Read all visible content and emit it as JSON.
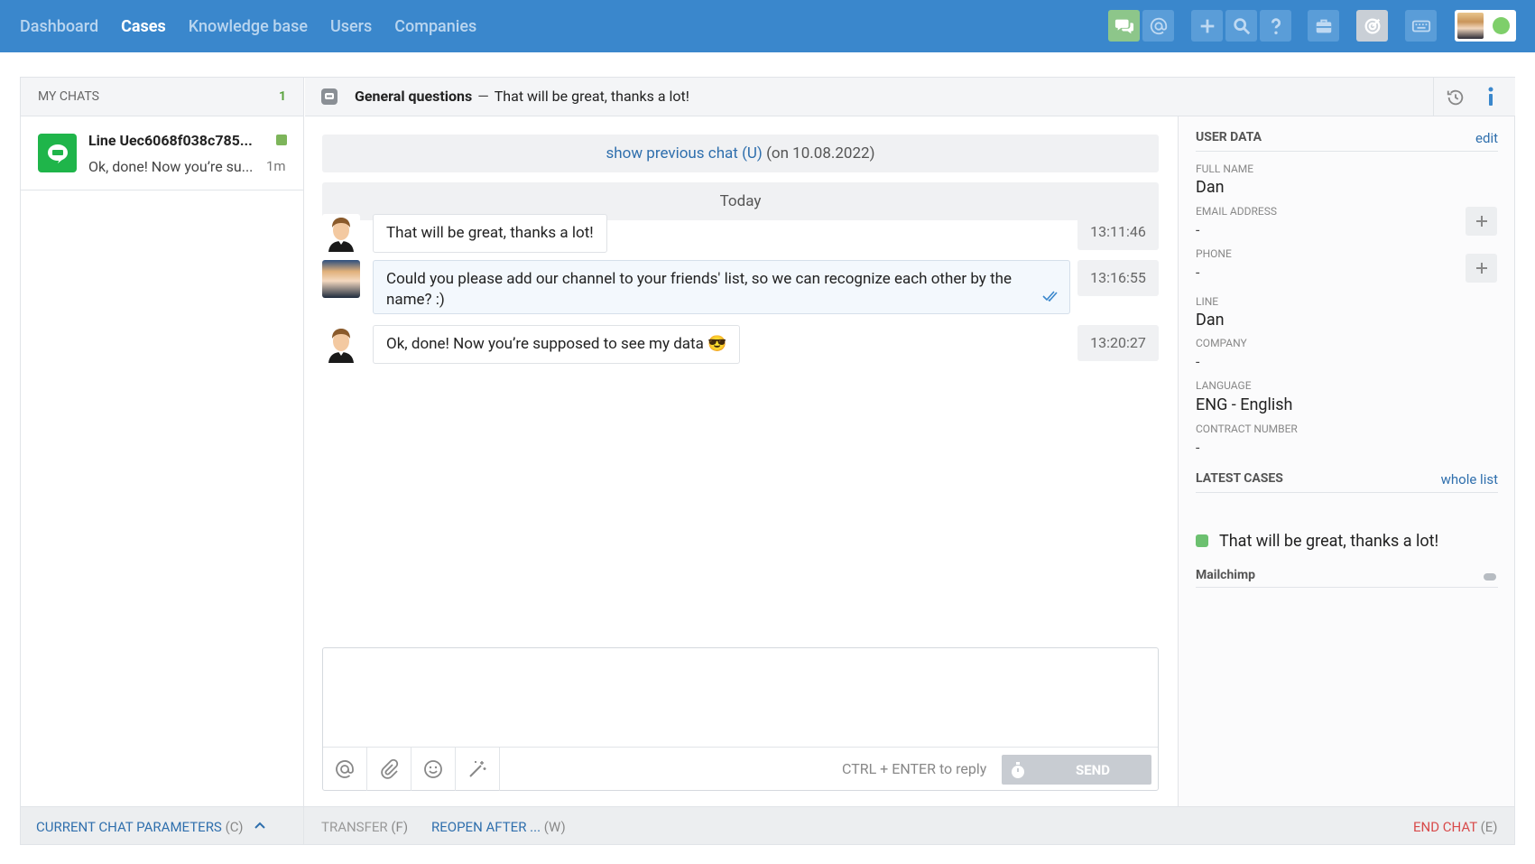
{
  "nav": {
    "items": [
      "Dashboard",
      "Cases",
      "Knowledge base",
      "Users",
      "Companies"
    ],
    "active": "Cases"
  },
  "toolbar": {
    "icons": [
      "chat-icon",
      "at-icon",
      "plus-icon",
      "search-icon",
      "help-icon",
      "briefcase-icon",
      "target-icon",
      "keyboard-icon"
    ],
    "status_color": "#7ecf6a"
  },
  "left": {
    "title": "MY CHATS",
    "count": "1",
    "chats": [
      {
        "name": "Line Uec6068f038c785...",
        "preview": "Ok, done! Now you’re su...",
        "ago": "1m"
      }
    ]
  },
  "conversation": {
    "topic": "General questions",
    "separator": "—",
    "subject": "That will be great, thanks a lot!",
    "previous_link": "show previous chat (U)",
    "previous_date": "(on 10.08.2022)",
    "day_label": "Today",
    "messages": [
      {
        "from": "customer",
        "text": "That will be great, thanks a lot!",
        "time": "13:11:46"
      },
      {
        "from": "agent",
        "text": "Could you please add our channel to your friends' list, so we can recognize each other by the name? :)",
        "time": "13:16:55"
      },
      {
        "from": "customer",
        "text": "Ok, done! Now you’re supposed to see my data 😎",
        "time": "13:20:27"
      }
    ],
    "composer": {
      "hint": "CTRL + ENTER to reply",
      "send_label": "SEND"
    }
  },
  "user_data": {
    "title": "USER DATA",
    "edit_label": "edit",
    "fields": [
      {
        "label": "FULL NAME",
        "value": "Dan"
      },
      {
        "label": "EMAIL ADDRESS",
        "value": "-"
      },
      {
        "label": "PHONE",
        "value": "-"
      },
      {
        "label": "LINE",
        "value": "Dan"
      },
      {
        "label": "COMPANY",
        "value": "-"
      },
      {
        "label": "LANGUAGE",
        "value": "ENG - English"
      },
      {
        "label": "CONTRACT NUMBER",
        "value": "-"
      }
    ],
    "latest_title": "LATEST CASES",
    "whole_list": "whole list",
    "latest_case": "That will be great, thanks a lot!",
    "mailchimp": "Mailchimp"
  },
  "bottom": {
    "params": "CURRENT CHAT PARAMETERS",
    "params_key": "(C)",
    "transfer": "TRANSFER",
    "transfer_key": "(F)",
    "reopen": "REOPEN AFTER ...",
    "reopen_key": "(W)",
    "end": "END CHAT",
    "end_key": "(E)"
  }
}
